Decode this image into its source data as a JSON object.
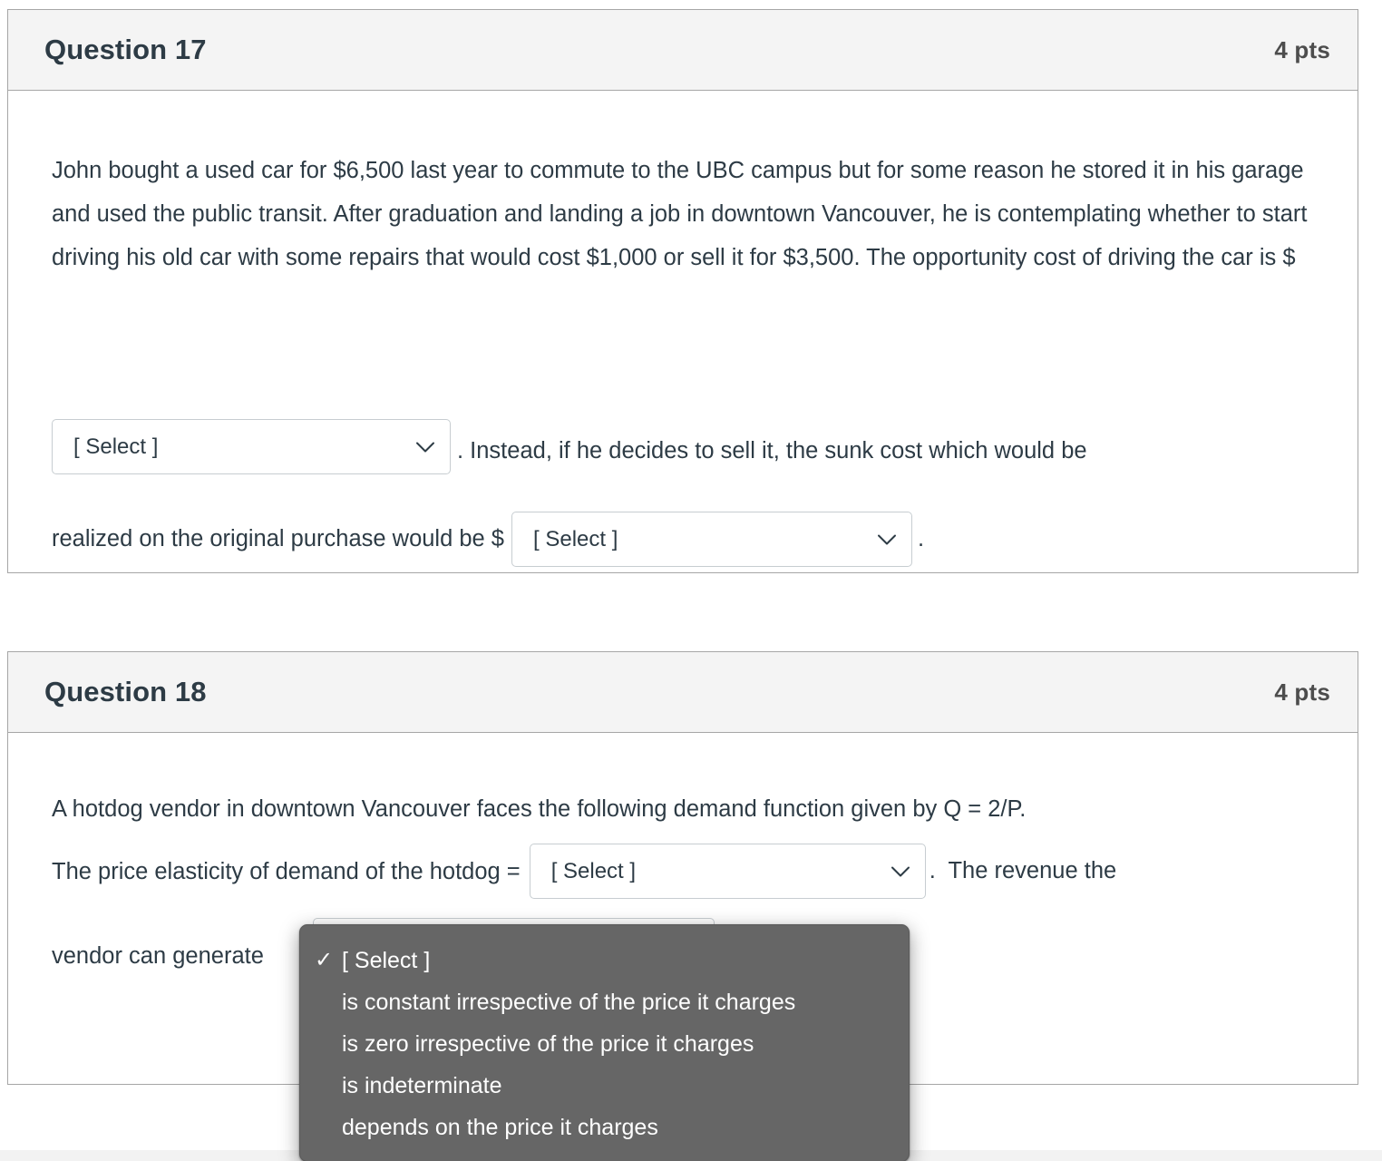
{
  "questions": [
    {
      "id": "q17",
      "title": "Question 17",
      "points": "4 pts",
      "body_text": "John bought a used car for $6,500 last year to commute to the UBC campus but for some reason he stored it in his garage and used  the public transit. After graduation and landing a job in downtown Vancouver, he is contemplating whether to start driving his old car with some repairs that would cost $1,000 or sell it for $3,500. The opportunity cost of driving the car is $",
      "select_a_value": "[ Select ]",
      "after_select_a": ". Instead, if he decides to sell it, the sunk cost which would be",
      "before_select_b": "realized on the original purchase would be $",
      "select_b_value": "[ Select ]",
      "after_select_b": "."
    },
    {
      "id": "q18",
      "title": "Question 18",
      "points": "4 pts",
      "line1": "A hotdog vendor in downtown Vancouver faces the following demand function given by Q = 2/P.",
      "before_select_a": "The price elasticity of demand of the hotdog =",
      "select_a_value": "[ Select ]",
      "after_select_a": ".  The revenue the",
      "before_select_b": "vendor can generate",
      "select_b_value": "[ Select ]"
    }
  ],
  "open_dropdown": {
    "owner": "q18-select-b",
    "options": [
      {
        "label": "[ Select ]",
        "checked": true
      },
      {
        "label": "is constant irrespective of the price it charges",
        "checked": false
      },
      {
        "label": "is zero irrespective of the price it charges",
        "checked": false
      },
      {
        "label": "is indeterminate",
        "checked": false
      },
      {
        "label": "depends on the price it charges",
        "checked": false
      }
    ],
    "checkmark_glyph": "✓"
  },
  "icons": {
    "chevron_down": "chevron-down-icon"
  },
  "colors": {
    "text": "#2d3b45",
    "header_bg": "#f4f4f4",
    "card_border": "#a6a6a6",
    "select_border": "#c7cdd1",
    "dropdown_bg": "#666666",
    "points_text": "#4d4d4d"
  }
}
